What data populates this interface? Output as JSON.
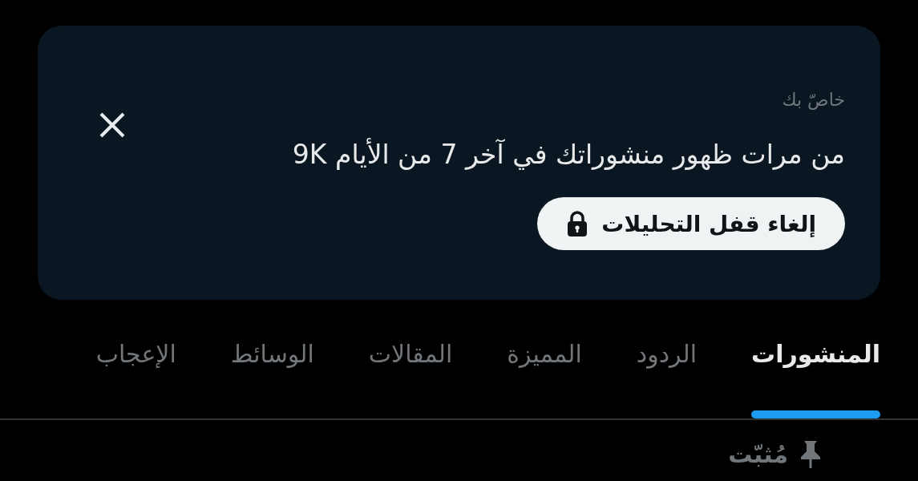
{
  "card": {
    "eyebrow": "خاصّ بك",
    "message": "من مرات ظهور منشوراتك في آخر 7 من الأيام 9K",
    "button": "إلغاء قفل التحليلات"
  },
  "tabs": [
    {
      "label": "المنشورات",
      "selected": true
    },
    {
      "label": "الردود",
      "selected": false
    },
    {
      "label": "المميزة",
      "selected": false
    },
    {
      "label": "المقالات",
      "selected": false
    },
    {
      "label": "الوسائط",
      "selected": false
    },
    {
      "label": "الإعجاب",
      "selected": false
    }
  ],
  "pinned": {
    "label": "مُثبّت"
  }
}
